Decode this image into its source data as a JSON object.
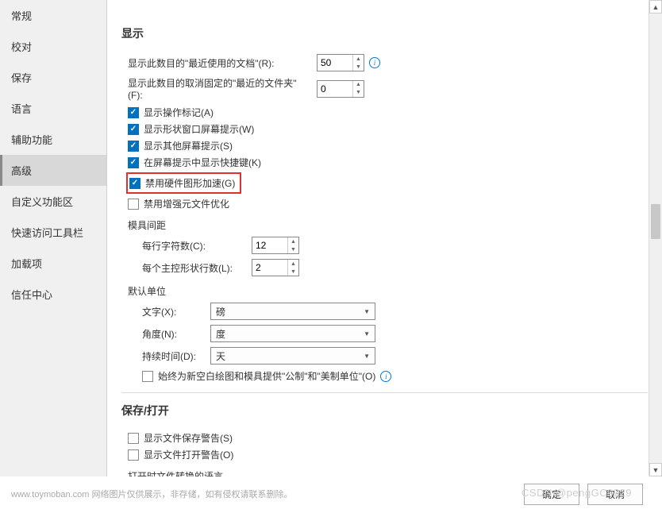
{
  "sidebar": {
    "items": [
      {
        "label": "常规"
      },
      {
        "label": "校对"
      },
      {
        "label": "保存"
      },
      {
        "label": "语言"
      },
      {
        "label": "辅助功能"
      },
      {
        "label": "高级"
      },
      {
        "label": "自定义功能区"
      },
      {
        "label": "快速访问工具栏"
      },
      {
        "label": "加载项"
      },
      {
        "label": "信任中心"
      }
    ],
    "active_index": 5
  },
  "sections": {
    "display": {
      "title": "显示",
      "recent_docs_label": "显示此数目的\"最近使用的文档\"(R):",
      "recent_docs_value": "50",
      "recent_folders_label": "显示此数目的取消固定的\"最近的文件夹\"(F):",
      "recent_folders_value": "0",
      "checkboxes": [
        {
          "label": "显示操作标记(A)",
          "checked": true
        },
        {
          "label": "显示形状窗口屏幕提示(W)",
          "checked": true
        },
        {
          "label": "显示其他屏幕提示(S)",
          "checked": true
        },
        {
          "label": "在屏幕提示中显示快捷键(K)",
          "checked": true
        },
        {
          "label": "禁用硬件图形加速(G)",
          "checked": true
        },
        {
          "label": "禁用增强元文件优化",
          "checked": false
        }
      ],
      "stencil_spacing": {
        "title": "模具间距",
        "chars_per_line_label": "每行字符数(C):",
        "chars_per_line_value": "12",
        "lines_per_master_label": "每个主控形状行数(L):",
        "lines_per_master_value": "2"
      },
      "default_units": {
        "title": "默认单位",
        "text_label": "文字(X):",
        "text_value": "磅",
        "angle_label": "角度(N):",
        "angle_value": "度",
        "duration_label": "持续时间(D):",
        "duration_value": "天",
        "metric_checkbox": {
          "label": "始终为新空白绘图和模具提供\"公制\"和\"美制单位\"(O)",
          "checked": false
        }
      }
    },
    "save_open": {
      "title": "保存/打开",
      "checkboxes": [
        {
          "label": "显示文件保存警告(S)",
          "checked": false
        },
        {
          "label": "显示文件打开警告(O)",
          "checked": false
        }
      ],
      "conversion_label": "打开时文件转换的语言"
    }
  },
  "buttons": {
    "ok": "确定",
    "cancel": "取消"
  },
  "footnote": "www.toymoban.com 网络图片仅供展示，非存储，如有侵权请联系删除。",
  "watermark": "CSDN @pengGC9229"
}
